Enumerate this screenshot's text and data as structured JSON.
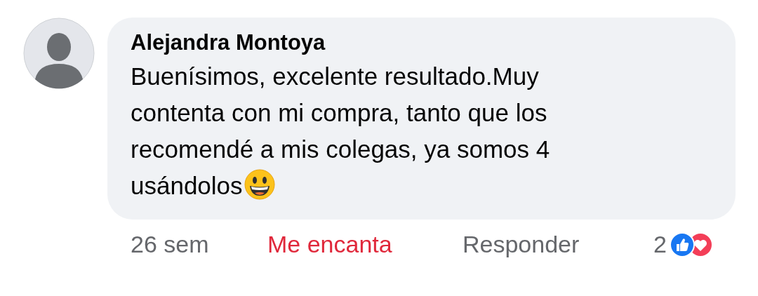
{
  "comment": {
    "author": "Alejandra Montoya",
    "body_lines": [
      "Buenísimos, excelente resultado.Muy",
      "contenta con mi compra, tanto que los",
      "recomendé a mis colegas, ya somos 4",
      "usándolos"
    ],
    "time": "26 sem",
    "reaction_link": {
      "label": "Me encanta",
      "reacted": true
    },
    "reply_link": {
      "label": "Responder"
    },
    "reaction_count": "2"
  }
}
